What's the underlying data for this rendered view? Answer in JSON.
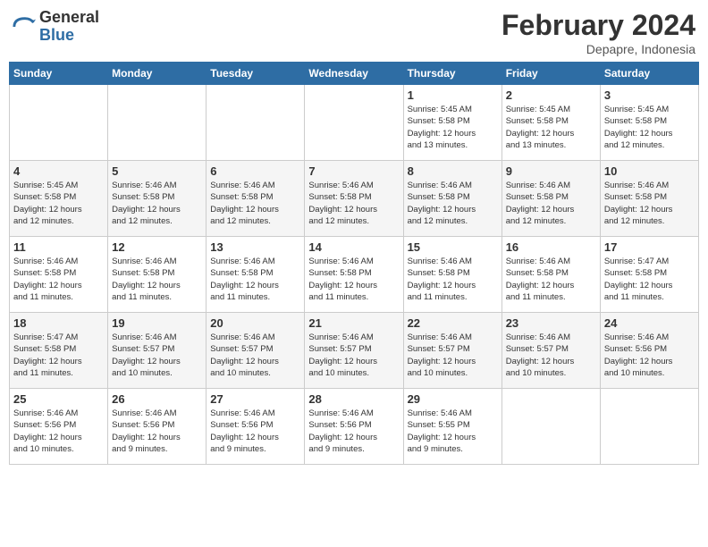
{
  "header": {
    "logo_general": "General",
    "logo_blue": "Blue",
    "month_year": "February 2024",
    "location": "Depapre, Indonesia"
  },
  "weekdays": [
    "Sunday",
    "Monday",
    "Tuesday",
    "Wednesday",
    "Thursday",
    "Friday",
    "Saturday"
  ],
  "weeks": [
    [
      {
        "day": "",
        "info": ""
      },
      {
        "day": "",
        "info": ""
      },
      {
        "day": "",
        "info": ""
      },
      {
        "day": "",
        "info": ""
      },
      {
        "day": "1",
        "info": "Sunrise: 5:45 AM\nSunset: 5:58 PM\nDaylight: 12 hours\nand 13 minutes."
      },
      {
        "day": "2",
        "info": "Sunrise: 5:45 AM\nSunset: 5:58 PM\nDaylight: 12 hours\nand 13 minutes."
      },
      {
        "day": "3",
        "info": "Sunrise: 5:45 AM\nSunset: 5:58 PM\nDaylight: 12 hours\nand 12 minutes."
      }
    ],
    [
      {
        "day": "4",
        "info": "Sunrise: 5:45 AM\nSunset: 5:58 PM\nDaylight: 12 hours\nand 12 minutes."
      },
      {
        "day": "5",
        "info": "Sunrise: 5:46 AM\nSunset: 5:58 PM\nDaylight: 12 hours\nand 12 minutes."
      },
      {
        "day": "6",
        "info": "Sunrise: 5:46 AM\nSunset: 5:58 PM\nDaylight: 12 hours\nand 12 minutes."
      },
      {
        "day": "7",
        "info": "Sunrise: 5:46 AM\nSunset: 5:58 PM\nDaylight: 12 hours\nand 12 minutes."
      },
      {
        "day": "8",
        "info": "Sunrise: 5:46 AM\nSunset: 5:58 PM\nDaylight: 12 hours\nand 12 minutes."
      },
      {
        "day": "9",
        "info": "Sunrise: 5:46 AM\nSunset: 5:58 PM\nDaylight: 12 hours\nand 12 minutes."
      },
      {
        "day": "10",
        "info": "Sunrise: 5:46 AM\nSunset: 5:58 PM\nDaylight: 12 hours\nand 12 minutes."
      }
    ],
    [
      {
        "day": "11",
        "info": "Sunrise: 5:46 AM\nSunset: 5:58 PM\nDaylight: 12 hours\nand 11 minutes."
      },
      {
        "day": "12",
        "info": "Sunrise: 5:46 AM\nSunset: 5:58 PM\nDaylight: 12 hours\nand 11 minutes."
      },
      {
        "day": "13",
        "info": "Sunrise: 5:46 AM\nSunset: 5:58 PM\nDaylight: 12 hours\nand 11 minutes."
      },
      {
        "day": "14",
        "info": "Sunrise: 5:46 AM\nSunset: 5:58 PM\nDaylight: 12 hours\nand 11 minutes."
      },
      {
        "day": "15",
        "info": "Sunrise: 5:46 AM\nSunset: 5:58 PM\nDaylight: 12 hours\nand 11 minutes."
      },
      {
        "day": "16",
        "info": "Sunrise: 5:46 AM\nSunset: 5:58 PM\nDaylight: 12 hours\nand 11 minutes."
      },
      {
        "day": "17",
        "info": "Sunrise: 5:47 AM\nSunset: 5:58 PM\nDaylight: 12 hours\nand 11 minutes."
      }
    ],
    [
      {
        "day": "18",
        "info": "Sunrise: 5:47 AM\nSunset: 5:58 PM\nDaylight: 12 hours\nand 11 minutes."
      },
      {
        "day": "19",
        "info": "Sunrise: 5:46 AM\nSunset: 5:57 PM\nDaylight: 12 hours\nand 10 minutes."
      },
      {
        "day": "20",
        "info": "Sunrise: 5:46 AM\nSunset: 5:57 PM\nDaylight: 12 hours\nand 10 minutes."
      },
      {
        "day": "21",
        "info": "Sunrise: 5:46 AM\nSunset: 5:57 PM\nDaylight: 12 hours\nand 10 minutes."
      },
      {
        "day": "22",
        "info": "Sunrise: 5:46 AM\nSunset: 5:57 PM\nDaylight: 12 hours\nand 10 minutes."
      },
      {
        "day": "23",
        "info": "Sunrise: 5:46 AM\nSunset: 5:57 PM\nDaylight: 12 hours\nand 10 minutes."
      },
      {
        "day": "24",
        "info": "Sunrise: 5:46 AM\nSunset: 5:56 PM\nDaylight: 12 hours\nand 10 minutes."
      }
    ],
    [
      {
        "day": "25",
        "info": "Sunrise: 5:46 AM\nSunset: 5:56 PM\nDaylight: 12 hours\nand 10 minutes."
      },
      {
        "day": "26",
        "info": "Sunrise: 5:46 AM\nSunset: 5:56 PM\nDaylight: 12 hours\nand 9 minutes."
      },
      {
        "day": "27",
        "info": "Sunrise: 5:46 AM\nSunset: 5:56 PM\nDaylight: 12 hours\nand 9 minutes."
      },
      {
        "day": "28",
        "info": "Sunrise: 5:46 AM\nSunset: 5:56 PM\nDaylight: 12 hours\nand 9 minutes."
      },
      {
        "day": "29",
        "info": "Sunrise: 5:46 AM\nSunset: 5:55 PM\nDaylight: 12 hours\nand 9 minutes."
      },
      {
        "day": "",
        "info": ""
      },
      {
        "day": "",
        "info": ""
      }
    ]
  ]
}
